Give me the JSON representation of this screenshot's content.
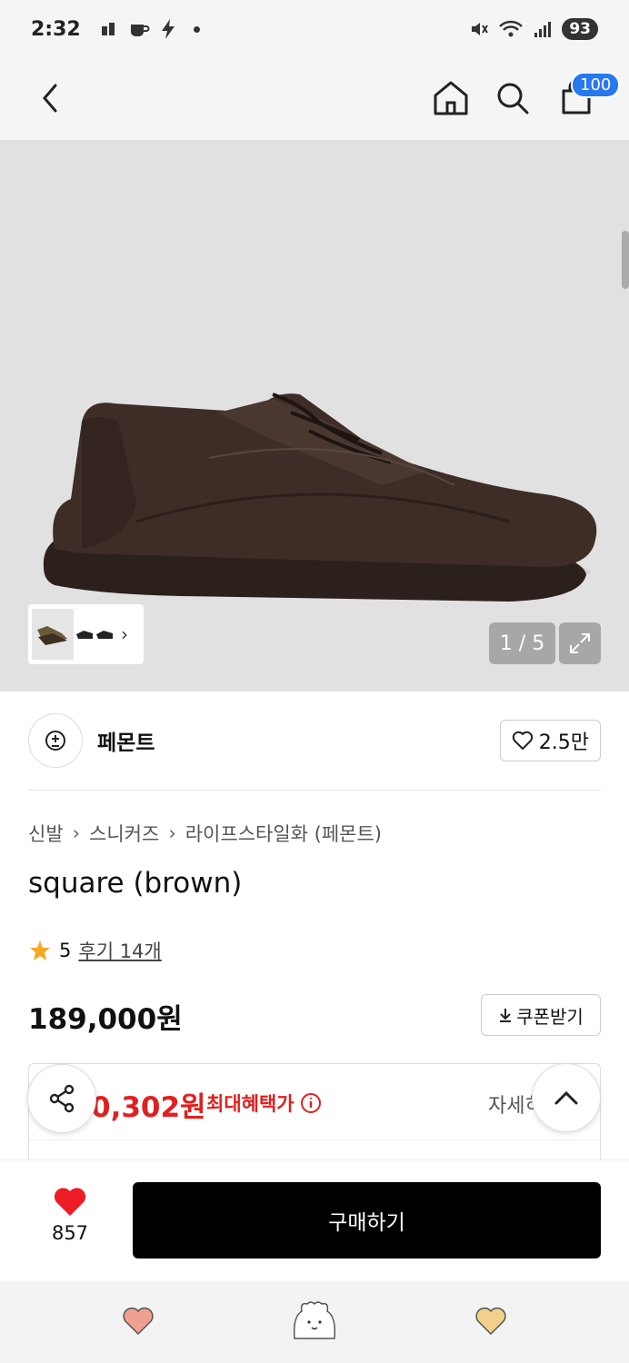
{
  "status": {
    "time": "2:32",
    "battery": "93"
  },
  "nav": {
    "cart_count": "100",
    "icons": [
      "back-arrow-icon",
      "home-icon",
      "search-icon",
      "cart-icon"
    ]
  },
  "gallery": {
    "counter": "1 / 5",
    "current_page": 1,
    "total_pages": 5
  },
  "brand": {
    "name": "페몬트",
    "likes": "2.5만"
  },
  "breadcrumb": [
    "신발",
    "스니커즈",
    "라이프스타일화 (페몬트)"
  ],
  "product": {
    "title": "square (brown)",
    "rating": "5",
    "reviews": "후기 14개",
    "price": "189,000원",
    "coupon": "쿠폰받기"
  },
  "benefit": {
    "price": "0,302원",
    "label": "최대혜택가",
    "detail": "자세히"
  },
  "purchase": {
    "wish_count": "857",
    "buy_label": "구매하기"
  },
  "colors": {
    "accent_red": "#e02020",
    "badge_blue": "#2878f0",
    "heart_red": "#ee1c25"
  }
}
